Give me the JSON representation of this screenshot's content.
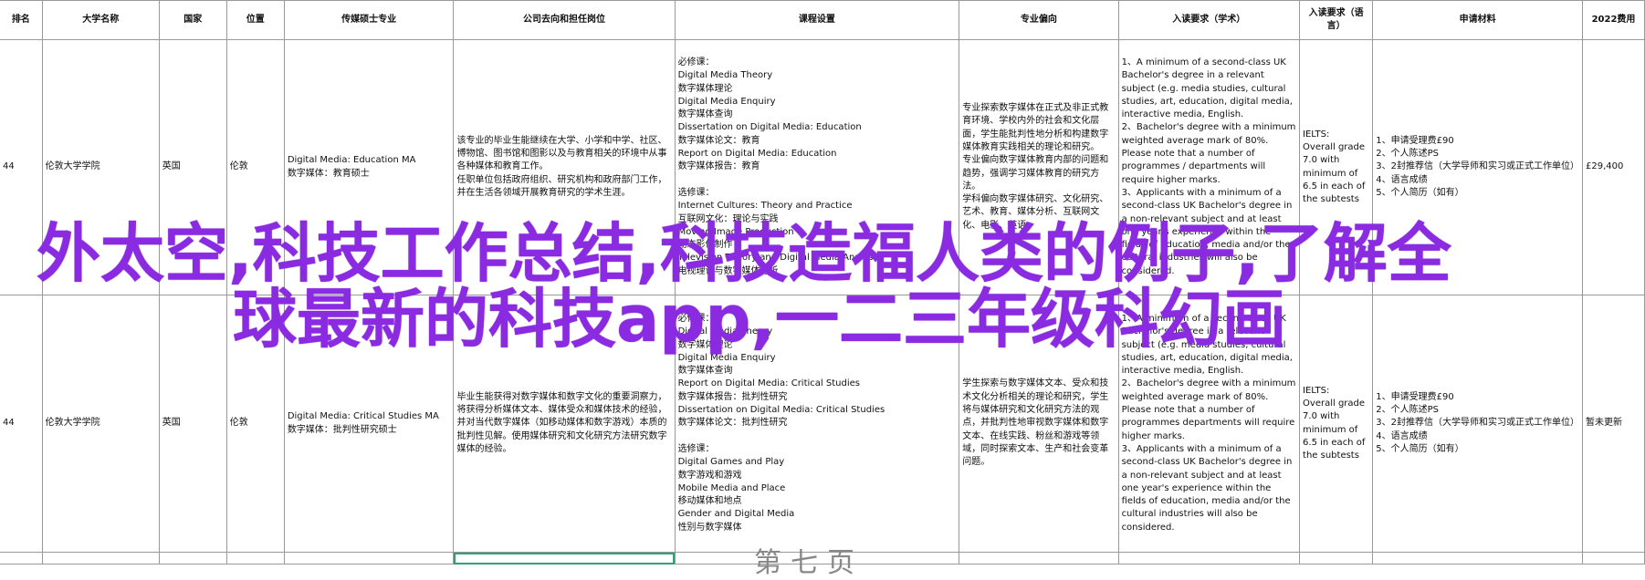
{
  "headers": [
    "排名",
    "大学名称",
    "国家",
    "位置",
    "传媒硕士专业",
    "公司去向和担任岗位",
    "课程设置",
    "专业偏向",
    "入读要求（学术）",
    "入读要求（语言）",
    "申请材料",
    "2022费用"
  ],
  "rows": [
    {
      "rank": "44",
      "university": "伦敦大学学院",
      "country": "英国",
      "location": "伦敦",
      "major_lines": [
        "Digital Media: Education MA",
        "数字媒体：教育硕士"
      ],
      "career": "该专业的毕业生能继续在大学、小学和中学、社区、博物馆、图书馆和图影以及与教育相关的环境中从事各种媒体和教育工作。\n任职单位包括政府组织、研究机构和政府部门工作，并在生活各领域开展教育研究的学术生涯。",
      "courses": [
        "必修课：",
        "Digital Media Theory",
        "数字媒体理论",
        "Digital Media Enquiry",
        "数字媒体查询",
        "Dissertation on Digital Media: Education",
        "数字媒体论文：教育",
        "Report on Digital Media: Education",
        "数字媒体报告：教育",
        "",
        "选修课：",
        "Internet Cultures: Theory and Practice",
        "互联网文化：理论与实践",
        "Moving Image Production",
        "动态影像制作",
        "Television Theory and Digital Media Analysis",
        "电视理论与数字媒体分析"
      ],
      "focus": "专业探索数字媒体在正式及非正式教育环境、学校内外的社会和文化层面，学生能批判性地分析和构建数字媒体教育实践相关的理论和研究。\n专业偏向数字媒体教育内部的问题和趋势，强调学习媒体教育的研究方法。\n学科偏向数字媒体研究、文化研究、艺术、教育、媒体分析、互联网文化、电影、英语。",
      "academic": "1、A minimum of a second-class UK Bachelor's degree in a relevant subject (e.g. media studies, cultural studies, art, education, digital media, interactive media, English.\n2、Bachelor's degree with a minimum weighted average mark of 80%. Please note that a number of programmes / departments will require higher marks.\n3、Applicants with a minimum of a second-class UK Bachelor's degree in a non-relevant subject and at least one year's experience within the fields of education, media and/or the cultural industries will also be considered.",
      "language": "IELTS:\nOverall grade 7.0 with minimum of 6.5 in each of the subtests",
      "materials": [
        "1、申请受理费£90",
        "2、个人陈述PS",
        "3、2封推荐信（大学导师和实习或正式工作单位）",
        "4、语言成绩",
        "5、个人简历（如有）"
      ],
      "fee": "£29,400"
    },
    {
      "rank": "44",
      "university": "伦敦大学学院",
      "country": "英国",
      "location": "伦敦",
      "major_lines": [
        "Digital Media: Critical Studies MA",
        "数字媒体：批判性研究硕士"
      ],
      "career": "毕业生能获得对数字媒体和数字文化的重要洞察力，将获得分析媒体文本、媒体受众和媒体技术的经验，并对当代数字媒体（如移动媒体和数字游戏）本质的批判性见解。使用媒体研究和文化研究方法研究数字媒体的经验。",
      "courses": [
        "必修课：",
        "Digital Media Theory",
        "数字媒体理论",
        "Digital Media Enquiry",
        "数字媒体查询",
        "Report on Digital Media: Critical Studies",
        "数字媒体报告：批判性研究",
        "Dissertation on Digital Media: Critical Studies",
        "数字媒体论文：批判性研究",
        "",
        "选修课：",
        "Digital Games and Play",
        "数字游戏和游戏",
        "Mobile Media and Place",
        "移动媒体和地点",
        "Gender and Digital Media",
        "性别与数字媒体"
      ],
      "focus": "学生探索与数字媒体文本、受众和技术文化分析相关的理论和研究，学生将与媒体研究和文化研究方法的观点，并批判性地审视数字媒体和数字文本、在线实践、粉丝和游戏等领域，同时探索文本、生产和社会变革问题。",
      "academic": "1、A minimum of a second-class UK Bachelor's degree in a relevant subject (e.g. media studies, cultural studies, art, education, digital media, interactive media, English.\n2、Bachelor's degree with a minimum weighted average mark of 80%. Please note that a number of programmes departments will require higher marks.\n3、Applicants with a minimum of a second-class UK Bachelor's degree in a non-relevant subject and at least one year's experience within the fields of education, media and/or the cultural industries will also be considered.",
      "language": "IELTS:\nOverall grade 7.0 with minimum of 6.5 in each of the subtests",
      "materials": [
        "1、申请受理费£90",
        "2、个人陈述PS",
        "3、2封推荐信（大学导师和实习或正式工作单位）",
        "4、语言成绩",
        "5、个人简历（如有）"
      ],
      "fee": "暂未更新"
    }
  ],
  "overlay": {
    "line1": "外太空,科技工作总结,科技造福人类的例子,了解全",
    "line2": "球最新的科技app,一二三年级科幻画"
  },
  "ghost_text": "第七页",
  "colors": {
    "overlay_text": "#8a2be2",
    "selection_border": "#2aa37a",
    "grid": "#9a9a9a"
  }
}
